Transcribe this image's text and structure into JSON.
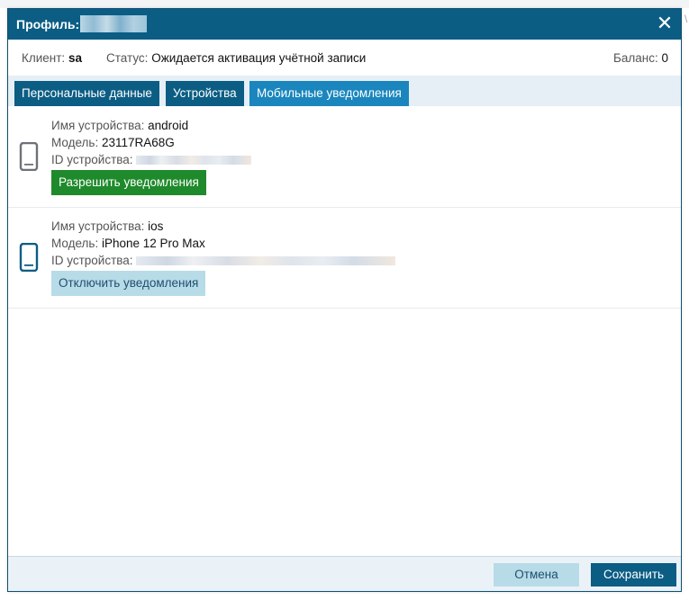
{
  "dialog": {
    "title": "Профиль:",
    "close_icon": "close-icon"
  },
  "info": {
    "client_label": "Клиент:",
    "client_value": "sa",
    "status_label": "Статус:",
    "status_value": "Ожидается активация учётной записи",
    "balance_label": "Баланс:",
    "balance_value": "0"
  },
  "tabs": [
    {
      "label": "Персональные данные",
      "active": false
    },
    {
      "label": "Устройства",
      "active": false
    },
    {
      "label": "Мобильные уведомления",
      "active": true
    }
  ],
  "devices": [
    {
      "icon": "phone-icon",
      "name_label": "Имя устройства:",
      "name": "android",
      "model_label": "Модель:",
      "model": "23117RA68G",
      "id_label": "ID устройства:",
      "button_label": "Разрешить уведомления"
    },
    {
      "icon": "phone-icon",
      "name_label": "Имя устройства:",
      "name": "ios",
      "model_label": "Модель:",
      "model": "iPhone 12 Pro Max",
      "id_label": "ID устройства:",
      "button_label": "Отключить уведомления"
    }
  ],
  "footer": {
    "cancel_label": "Отмена",
    "save_label": "Сохранить"
  },
  "colors": {
    "titlebar": "#0b5d84",
    "active_tab": "#1a86bd",
    "allow_button": "#1f8a2b",
    "disable_button": "#b8dbe8"
  }
}
